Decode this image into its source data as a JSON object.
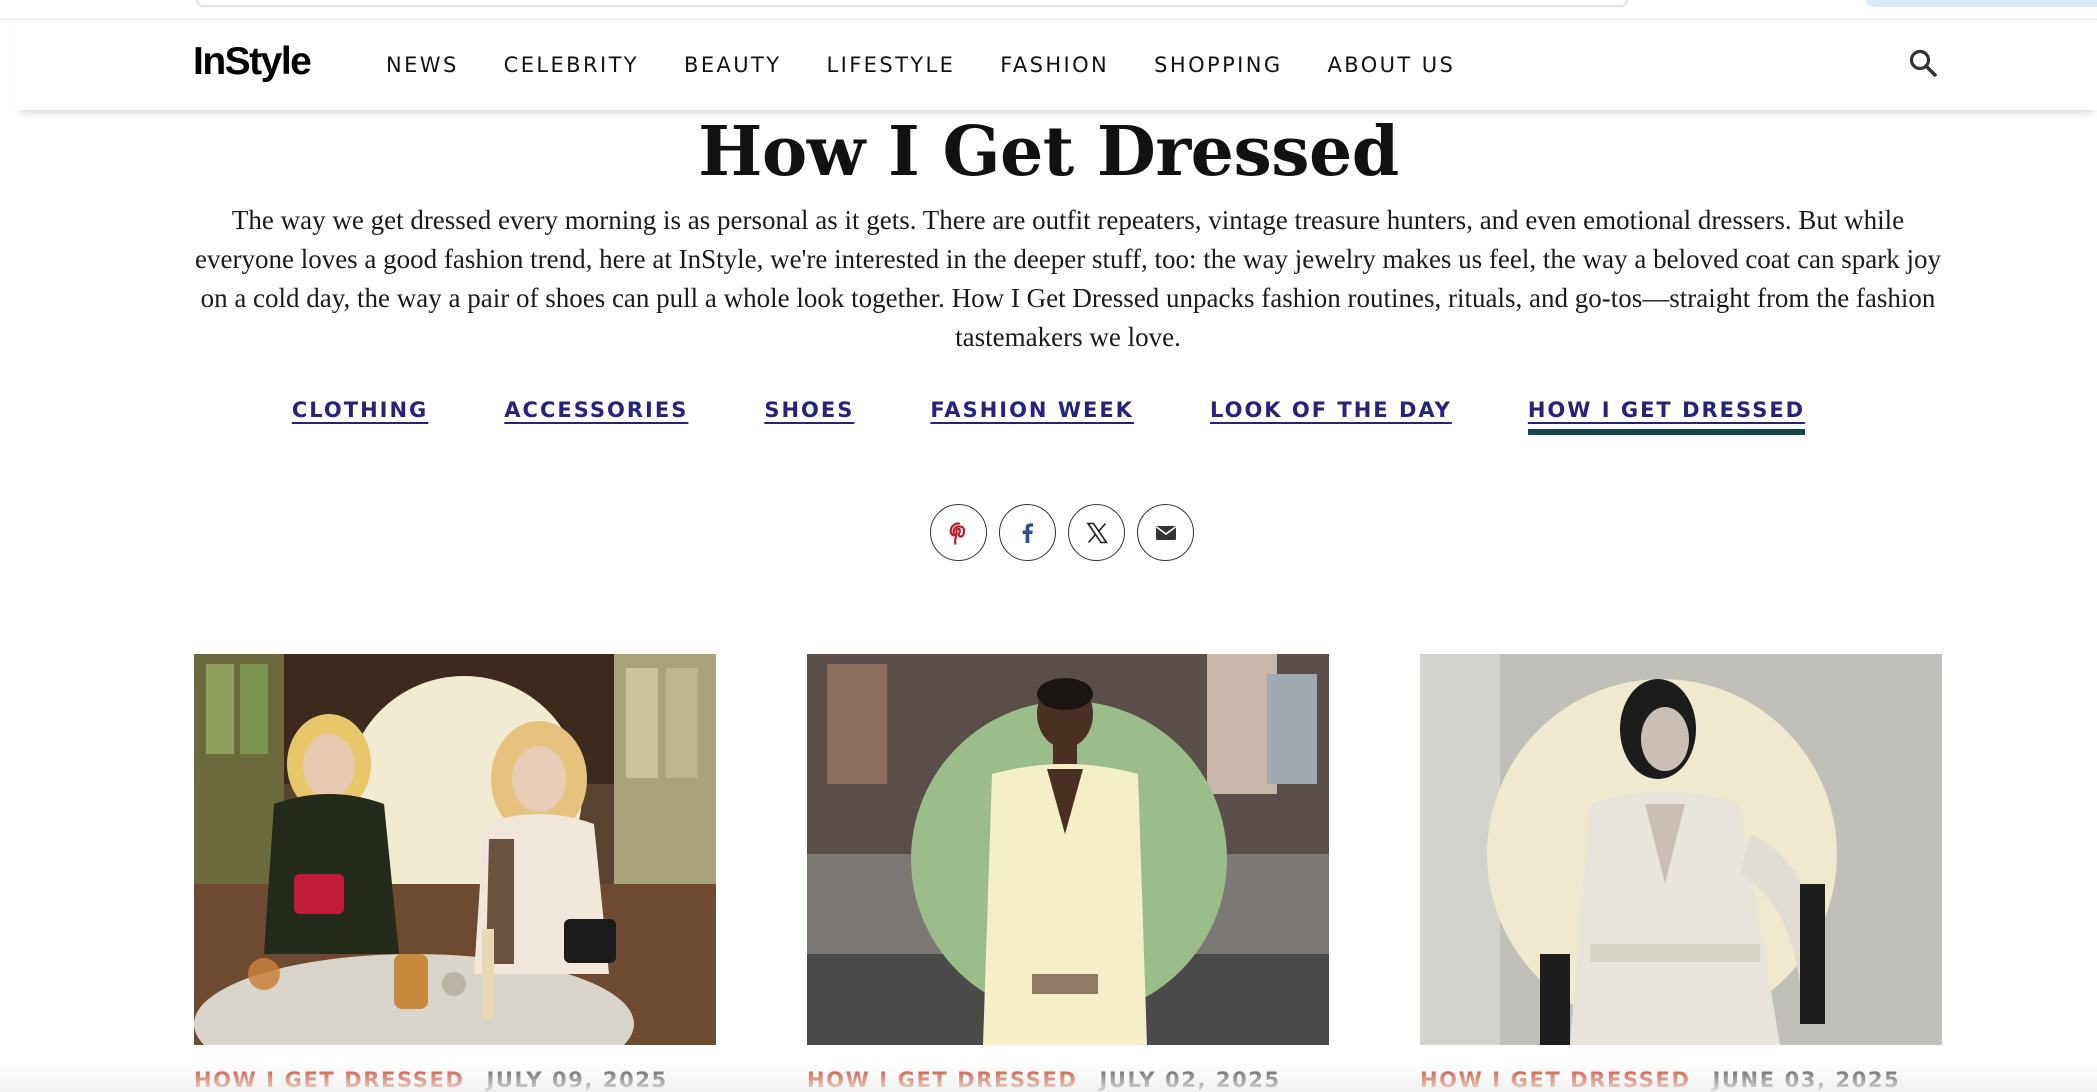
{
  "site": {
    "logo": "InStyle",
    "nav": [
      "NEWS",
      "CELEBRITY",
      "BEAUTY",
      "LIFESTYLE",
      "FASHION",
      "SHOPPING",
      "ABOUT US"
    ]
  },
  "page": {
    "title": "How I Get Dressed",
    "intro": "The way we get dressed every morning is as personal as it gets. There are outfit repeaters, vintage treasure hunters, and even emotional dressers. But while everyone loves a good fashion trend, here at InStyle, we're interested in the deeper stuff, too: the way jewelry makes us feel, the way a beloved coat can spark joy on a cold day, the way a pair of shoes can pull a whole look together. How I Get Dressed unpacks fashion routines, rituals, and go-tos—straight from the fashion tastemakers we love."
  },
  "subnav": {
    "items": [
      "CLOTHING",
      "ACCESSORIES",
      "SHOES",
      "FASHION WEEK",
      "LOOK OF THE DAY",
      "HOW I GET DRESSED"
    ],
    "active": "HOW I GET DRESSED"
  },
  "share": [
    "pinterest-icon",
    "facebook-icon",
    "x-icon",
    "email-icon"
  ],
  "cards": [
    {
      "tag": "HOW I GET DRESSED",
      "date": "JULY 09, 2025"
    },
    {
      "tag": "HOW I GET DRESSED",
      "date": "JULY 02, 2025"
    },
    {
      "tag": "HOW I GET DRESSED",
      "date": "JUNE 03, 2025"
    }
  ],
  "colors": {
    "link": "#26237e",
    "active_underline": "#0f4a4a",
    "tag": "#c8371b",
    "circle_cream": "#f1ebd2",
    "circle_green": "#9cbd8a"
  }
}
